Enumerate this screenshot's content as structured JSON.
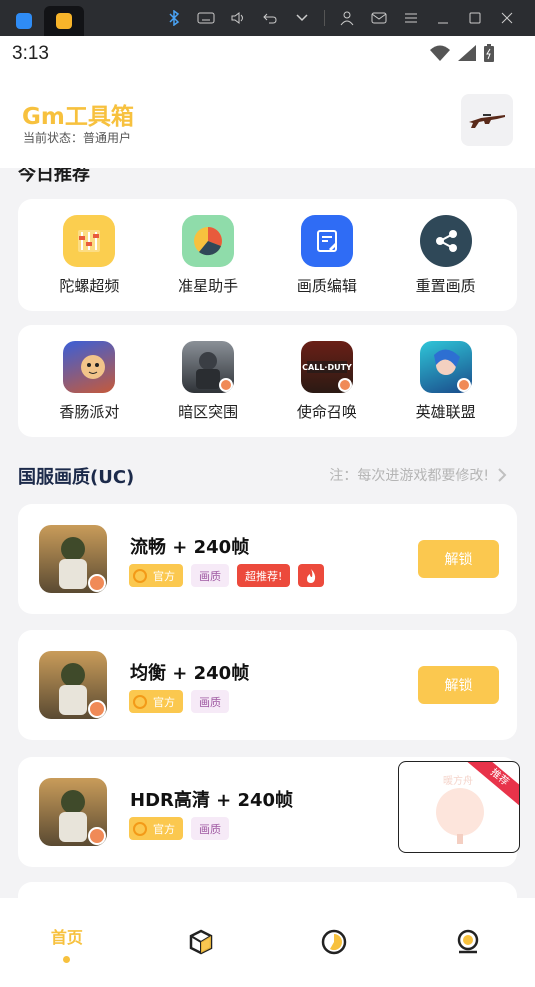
{
  "colors": {
    "accent": "#f7c13e",
    "unlock": "#fbc84f",
    "hot": "#ec4a3c",
    "quality_tag_bg": "#f6eaf7",
    "quality_tag_fg": "#a05aa3"
  },
  "status_bar": {
    "time": "3:13"
  },
  "header": {
    "title": "Gm工具箱",
    "status": "当前状态：普通用户",
    "gun_icon": "rifle-icon"
  },
  "today": {
    "title": "今日推荐"
  },
  "tools": [
    {
      "label": "陀螺超频",
      "icon": "sliders-icon",
      "color": "#fbce4f"
    },
    {
      "label": "准星助手",
      "icon": "pie-chart-icon",
      "color": "#8fdcaa"
    },
    {
      "label": "画质编辑",
      "icon": "edit-document-icon",
      "color": "#2f6cf5"
    },
    {
      "label": "重置画质",
      "icon": "share-icon",
      "color": "#2f4858"
    }
  ],
  "games": [
    {
      "label": "香肠派对",
      "icon": "sausage-party-icon"
    },
    {
      "label": "暗区突围",
      "icon": "arena-breakout-icon"
    },
    {
      "label": "使命召唤",
      "icon": "call-of-duty-icon"
    },
    {
      "label": "英雄联盟",
      "icon": "league-of-legends-icon"
    }
  ],
  "section": {
    "title": "国服画质(UC)",
    "note": "注：每次进游戏都要修改!"
  },
  "presets": [
    {
      "title": "流畅 + 240帧",
      "tag_official": "官方",
      "tag_quality": "画质",
      "tag_hot": "超推荐!",
      "fire": true,
      "button": "解锁"
    },
    {
      "title": "均衡 + 240帧",
      "tag_official": "官方",
      "tag_quality": "画质",
      "button": "解锁"
    },
    {
      "title": "HDR高清 + 240帧",
      "tag_official": "官方",
      "tag_quality": "画质"
    }
  ],
  "ad": {
    "ribbon": "推荐",
    "text": "暖方舟"
  },
  "bottom_nav": {
    "home_label": "首页",
    "items": [
      "home",
      "cube-icon",
      "chart-icon",
      "profile-icon"
    ]
  }
}
